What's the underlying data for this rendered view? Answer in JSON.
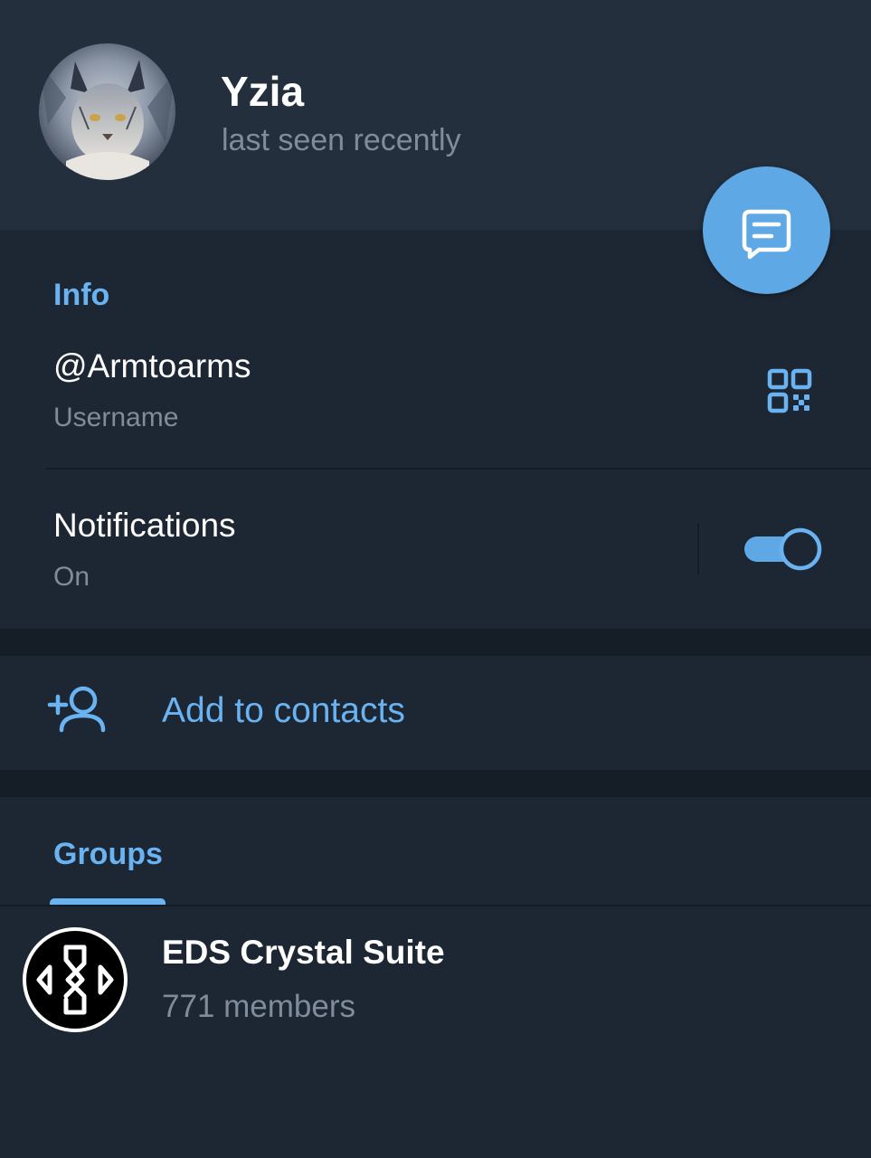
{
  "profile": {
    "name": "Yzia",
    "status": "last seen recently"
  },
  "info": {
    "section_title": "Info",
    "username": {
      "value": "@Armtoarms",
      "label": "Username"
    },
    "notifications": {
      "label": "Notifications",
      "state": "On",
      "enabled": true
    }
  },
  "actions": {
    "add_to_contacts": "Add to contacts"
  },
  "tabs": [
    {
      "label": "Groups",
      "selected": true
    }
  ],
  "groups": [
    {
      "name": "EDS Crystal Suite",
      "members": "771 members"
    }
  ],
  "icons": {
    "fab": "message-icon",
    "qr": "qr-code-icon",
    "add_contact": "add-user-icon"
  },
  "colors": {
    "accent": "#6ab3f3",
    "fab": "#5fa8e6",
    "background": "#1d2733",
    "header": "#232f3d",
    "secondary_text": "#7f8c9a"
  }
}
